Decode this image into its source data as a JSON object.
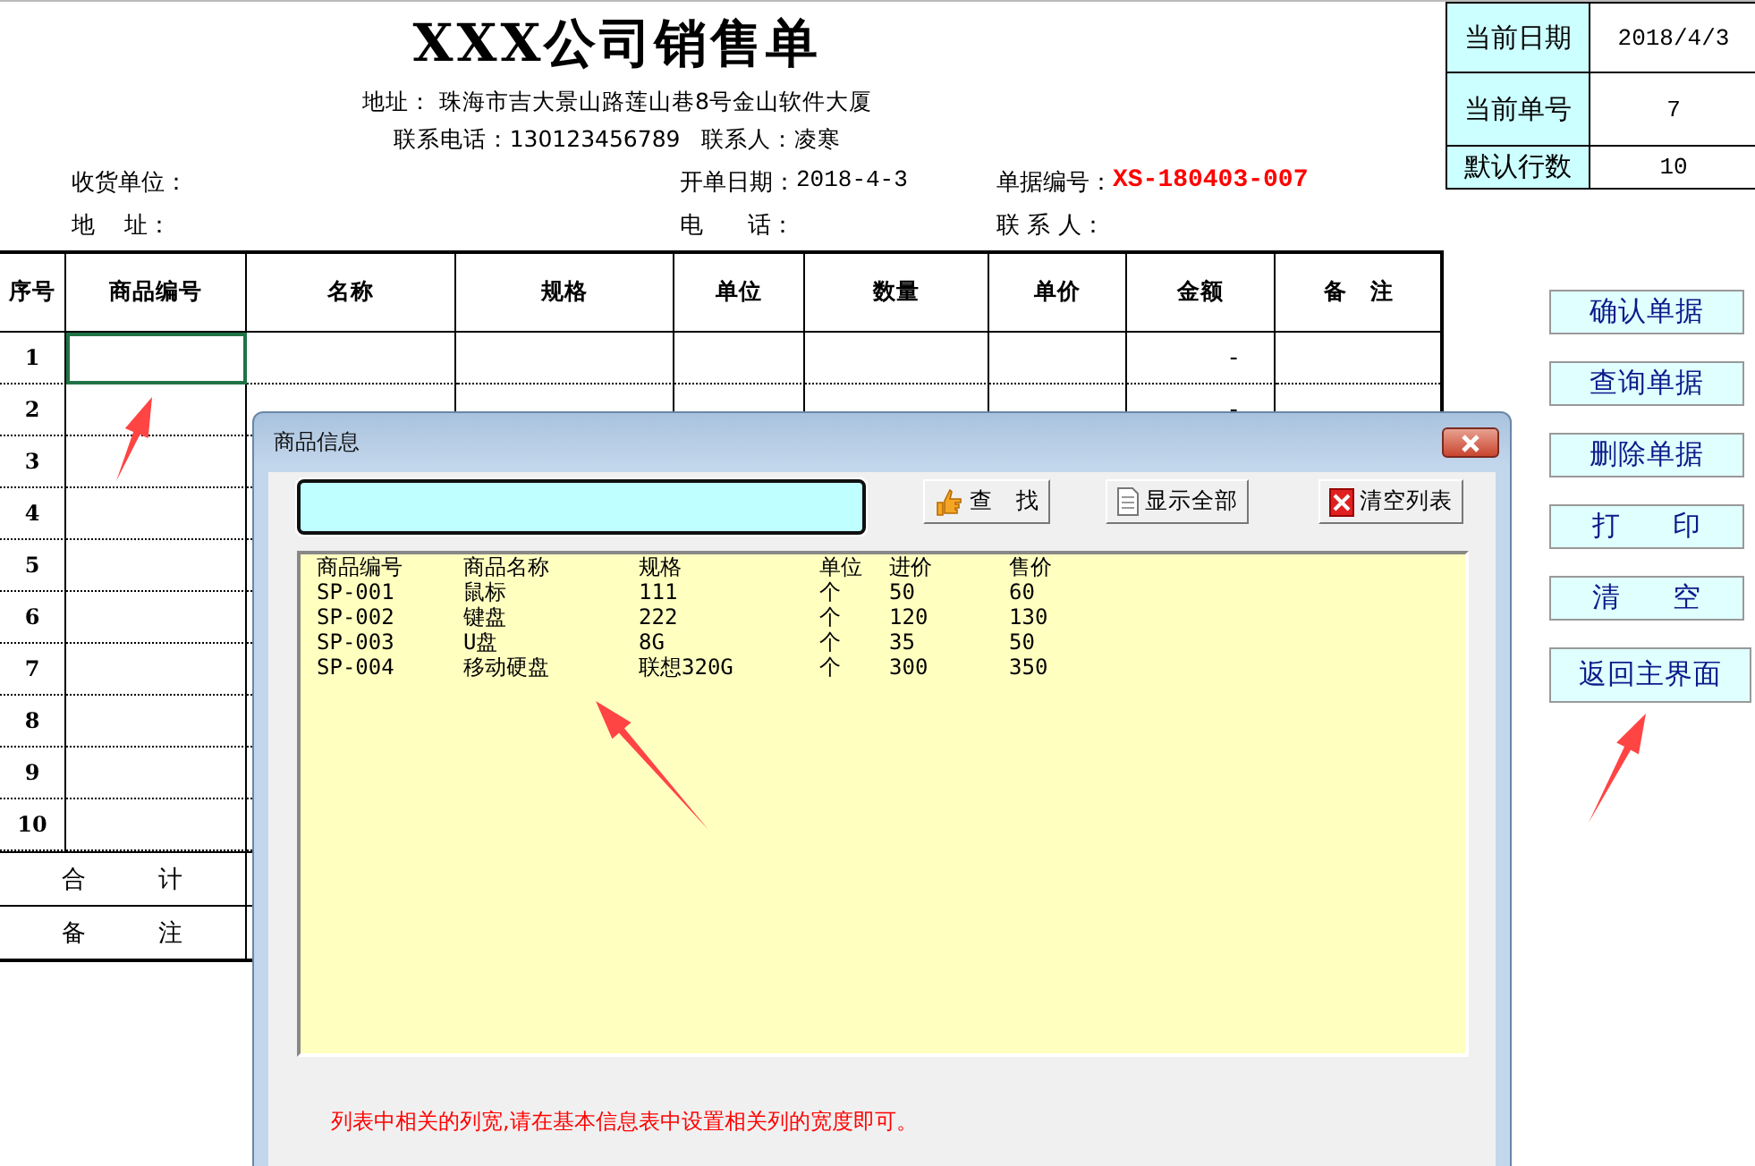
{
  "sheet": {
    "title": "XXX公司销售单",
    "address": "地址： 珠海市吉大景山路莲山巷8号金山软件大厦",
    "contact": "联系电话：130123456789   联系人：凌寒",
    "fields": [
      {
        "label": "收货单位："
      },
      {
        "label": "开单日期：",
        "value": "2018-4-3"
      },
      {
        "label": "单据编号：",
        "value": "XS-180403-007",
        "kind": "code"
      },
      {
        "label": "地    址："
      },
      {
        "label": "电      话："
      },
      {
        "label": "联 系 人："
      }
    ],
    "columns": [
      "序号",
      "商品编号",
      "名称",
      "规格",
      "单位",
      "数量",
      "单价",
      "金额",
      "备　注"
    ],
    "rows": [
      {
        "no": "1",
        "amount": "-",
        "selected": true
      },
      {
        "no": "2",
        "amount": "-",
        "selected": false
      },
      {
        "no": "3",
        "selected": false
      },
      {
        "no": "4",
        "selected": false
      },
      {
        "no": "5",
        "selected": false
      },
      {
        "no": "6",
        "selected": false
      },
      {
        "no": "7",
        "selected": false
      },
      {
        "no": "8",
        "selected": false
      },
      {
        "no": "9",
        "selected": false
      },
      {
        "no": "10",
        "selected": false
      }
    ],
    "footer": [
      "合 计",
      "备 注"
    ]
  },
  "info": [
    {
      "label": "当前日期",
      "value": "2018/4/3"
    },
    {
      "label": "当前单号",
      "value": "7"
    },
    {
      "label": "默认行数",
      "value": "10"
    }
  ],
  "buttons": [
    "确认单据",
    "查询单据",
    "删除单据",
    "打 印",
    "清 空",
    "返回主界面"
  ],
  "dialog": {
    "title": "商品信息",
    "buttons": [
      {
        "label": "查　找",
        "kind": "hand"
      },
      {
        "label": "显示全部",
        "kind": "page"
      },
      {
        "label": "清空列表",
        "kind": "clear"
      }
    ],
    "list": {
      "header": [
        "商品编号",
        "商品名称",
        "规格",
        "单位",
        "进价",
        "售价"
      ],
      "rows": [
        [
          "SP-001",
          "鼠标",
          "111",
          "个",
          "50",
          "60"
        ],
        [
          "SP-002",
          "键盘",
          "222",
          "个",
          "120",
          "130"
        ],
        [
          "SP-003",
          "U盘",
          "8G",
          "个",
          "35",
          "50"
        ],
        [
          "SP-004",
          "移动硬盘",
          "联想320G",
          "个",
          "300",
          "350"
        ]
      ]
    },
    "note": "列表中相关的列宽,请在基本信息表中设置相关列的宽度即可。"
  }
}
